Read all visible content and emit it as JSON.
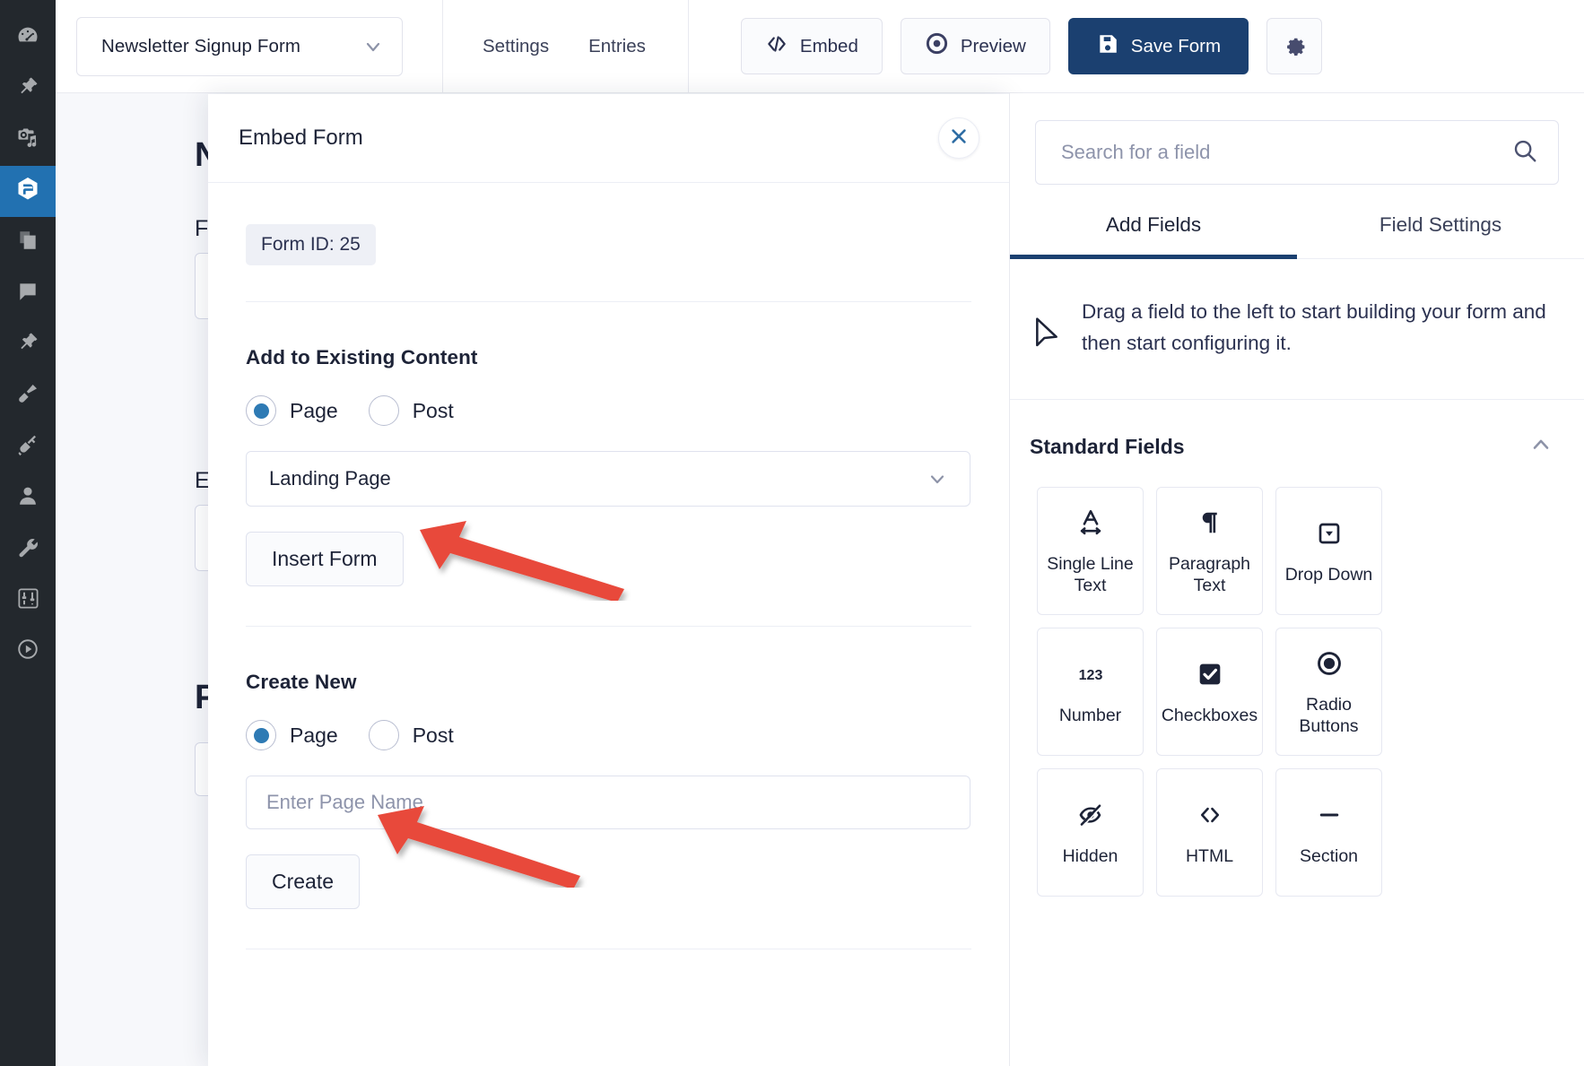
{
  "adminbar": {
    "items": [
      {
        "icon": "dashboard-gauge-icon",
        "active": false
      },
      {
        "icon": "pin-icon",
        "active": false
      },
      {
        "icon": "media-camera-music-icon",
        "active": false
      },
      {
        "icon": "gravity-forms-logo-icon",
        "active": true
      },
      {
        "icon": "pages-copy-icon",
        "active": false
      },
      {
        "icon": "comment-bubble-icon",
        "active": false
      },
      {
        "icon": "plugin-pin-icon",
        "active": false
      },
      {
        "icon": "appearance-brush-icon",
        "active": false
      },
      {
        "icon": "plugins-plug-icon",
        "active": false
      },
      {
        "icon": "users-person-icon",
        "active": false
      },
      {
        "icon": "tools-wrench-icon",
        "active": false
      },
      {
        "icon": "settings-sliders-icon",
        "active": false
      },
      {
        "icon": "media-play-icon",
        "active": false
      }
    ]
  },
  "topbar": {
    "form_name": "Newsletter Signup Form",
    "tabs": [
      {
        "label": "Settings"
      },
      {
        "label": "Entries"
      }
    ],
    "embed_label": "Embed",
    "preview_label": "Preview",
    "save_label": "Save Form",
    "embed_icon": "code-brackets-icon",
    "preview_icon": "eye-target-icon",
    "save_icon": "floppy-disk-icon",
    "gear_icon": "gear-icon",
    "chevron_icon": "chevron-down-icon",
    "primary_color": "#1b4070"
  },
  "canvas": {
    "heading": "Newsletter Signup",
    "label_first": "First Name",
    "label_email": "Email",
    "label_pref": "Preferences"
  },
  "modal": {
    "title": "Embed Form",
    "close_icon": "close-x-icon",
    "form_id": "Form ID: 25",
    "existing": {
      "title": "Add to Existing Content",
      "options": [
        {
          "label": "Page",
          "selected": true
        },
        {
          "label": "Post",
          "selected": false
        }
      ],
      "select_value": "Landing Page",
      "button_label": "Insert Form"
    },
    "create": {
      "title": "Create New",
      "options": [
        {
          "label": "Page",
          "selected": true
        },
        {
          "label": "Post",
          "selected": false
        }
      ],
      "input_value": "",
      "input_placeholder": "Enter Page Name",
      "button_label": "Create"
    },
    "annotations": {
      "arrow_color": "#e8493a",
      "arrow_insert_form": "arrow-pointing-to-insert-form",
      "arrow_create": "arrow-pointing-to-create"
    }
  },
  "rightpanel": {
    "search_placeholder": "Search for a field",
    "search_value": "",
    "search_icon": "search-magnifier-icon",
    "tabs": [
      {
        "label": "Add Fields",
        "active": true
      },
      {
        "label": "Field Settings",
        "active": false
      }
    ],
    "hint_icon": "mouse-cursor-arrow-icon",
    "hint_text": "Drag a field to the left to start building your form and then start configuring it.",
    "standard_fields": {
      "title": "Standard Fields",
      "collapse_icon": "chevron-up-icon",
      "fields": [
        {
          "label": "Single Line Text",
          "icon": "letter-a-arrows-icon"
        },
        {
          "label": "Paragraph Text",
          "icon": "pilcrow-icon"
        },
        {
          "label": "Drop Down",
          "icon": "dropdown-box-icon"
        },
        {
          "label": "Number",
          "icon": "digits-123-icon"
        },
        {
          "label": "Checkboxes",
          "icon": "checkbox-checked-icon"
        },
        {
          "label": "Radio Buttons",
          "icon": "radio-filled-icon"
        },
        {
          "label": "Hidden",
          "icon": "eye-slash-icon"
        },
        {
          "label": "HTML",
          "icon": "angle-brackets-icon"
        },
        {
          "label": "Section",
          "icon": "horizontal-line-icon"
        }
      ]
    }
  }
}
